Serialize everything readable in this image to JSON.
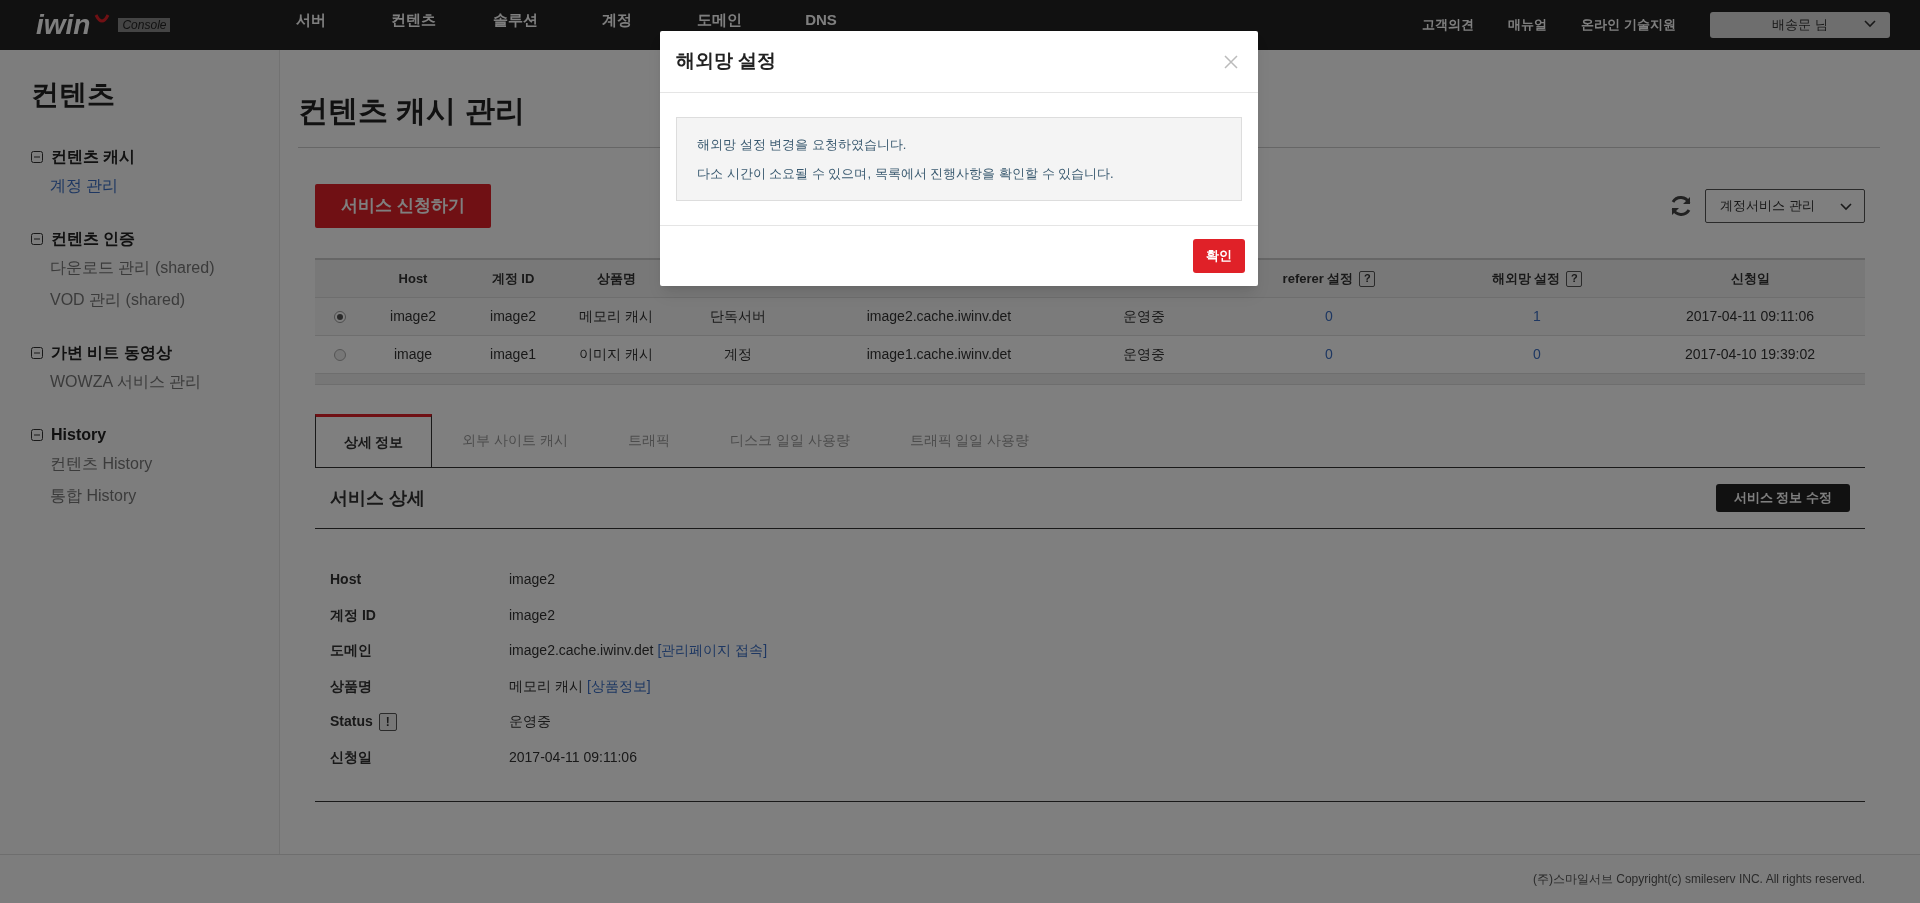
{
  "header": {
    "logo": "iwin",
    "logo_badge": "Console",
    "nav": [
      {
        "label": "서버"
      },
      {
        "label": "컨텐츠"
      },
      {
        "label": "솔루션"
      },
      {
        "label": "계정"
      },
      {
        "label": "도메인"
      },
      {
        "label": "DNS"
      }
    ],
    "links": [
      "고객의견",
      "매뉴얼",
      "온라인 기술지원"
    ],
    "user_menu": "배송문 님"
  },
  "sidebar": {
    "title": "컨텐츠",
    "groups": [
      {
        "label": "컨텐츠 캐시",
        "expanded": true,
        "items": [
          {
            "label": "계정 관리",
            "selected": true
          }
        ]
      },
      {
        "label": "컨텐츠 인증",
        "expanded": true,
        "items": [
          {
            "label": "다운로드 관리 (shared)",
            "selected": false
          },
          {
            "label": "VOD 관리 (shared)",
            "selected": false
          }
        ]
      },
      {
        "label": "가변 비트 동영상",
        "expanded": true,
        "items": [
          {
            "label": "WOWZA 서비스 관리",
            "selected": false
          }
        ]
      },
      {
        "label": "History",
        "expanded": true,
        "items": [
          {
            "label": "컨텐츠 History",
            "selected": false
          },
          {
            "label": "통합 History",
            "selected": false
          }
        ]
      }
    ]
  },
  "page": {
    "title": "컨텐츠 캐시 관리",
    "apply_button": "서비스 신청하기",
    "service_select": "계정서비스 관리"
  },
  "table": {
    "columns": [
      {
        "label": "Host"
      },
      {
        "label": "계정 ID"
      },
      {
        "label": "상품명"
      },
      {},
      {},
      {},
      {
        "label": "referer 설정",
        "help": "?"
      },
      {
        "label": "해외망 설정",
        "help": "?"
      },
      {
        "label": "신청일"
      }
    ],
    "rows": [
      {
        "selected": true,
        "cells": [
          "image2",
          "image2",
          "메모리 캐시",
          "단독서버",
          "image2.cache.iwinv.det",
          "운영중",
          "0",
          "1",
          "2017-04-11 09:11:06"
        ]
      },
      {
        "selected": false,
        "cells": [
          "image",
          "image1",
          "이미지 캐시",
          "계정",
          "image1.cache.iwinv.det",
          "운영중",
          "0",
          "0",
          "2017-04-10 19:39:02"
        ]
      }
    ]
  },
  "tabs": [
    {
      "label": "상세 정보",
      "selected": true
    },
    {
      "label": "외부 사이트 캐시",
      "selected": false
    },
    {
      "label": "트래픽",
      "selected": false
    },
    {
      "label": "디스크 일일 사용량",
      "selected": false
    },
    {
      "label": "트래픽 일일 사용량",
      "selected": false
    }
  ],
  "detail": {
    "title": "서비스 상세",
    "edit_button": "서비스 정보 수정",
    "rows": [
      {
        "label": "Host",
        "value": "image2"
      },
      {
        "label": "계정 ID",
        "value": "image2"
      },
      {
        "label": "도메인",
        "value": "image2.cache.iwinv.det",
        "link": "[관리페이지 접속]"
      },
      {
        "label": "상품명",
        "value": "메모리 캐시",
        "link": "[상품정보]"
      },
      {
        "label": "Status",
        "help": "!",
        "value": "운영중"
      },
      {
        "label": "신청일",
        "value": "2017-04-11 09:11:06"
      }
    ]
  },
  "footer": "(주)스마일서브 Copyright(c) smileserv INC. All rights reserved.",
  "modal": {
    "title": "해외망 설정",
    "messages": [
      "해외망 설정 변경을 요청하였습니다.",
      "다소 시간이 소요될 수 있으며, 목록에서 진행사항을 확인할 수 있습니다."
    ],
    "confirm_button": "확인"
  }
}
